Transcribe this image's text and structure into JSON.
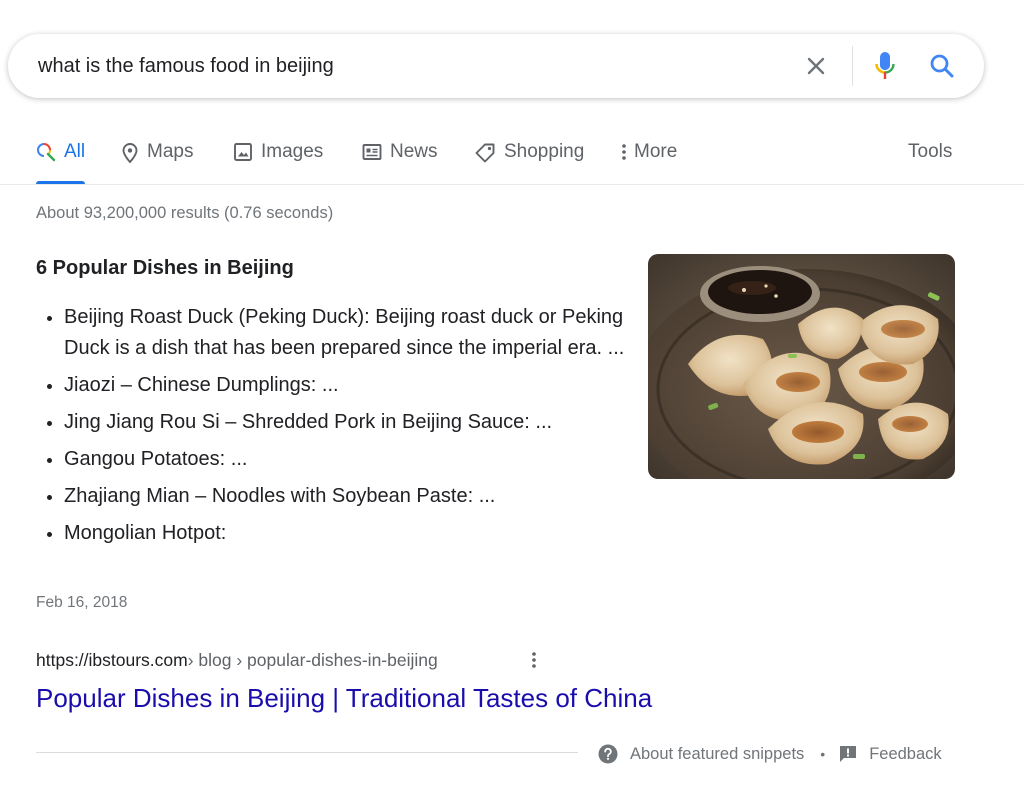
{
  "search": {
    "query": "what is the famous food in beijing"
  },
  "tabs": [
    {
      "label": "All",
      "icon": "search-icon",
      "active": true
    },
    {
      "label": "Maps",
      "icon": "map-pin-icon"
    },
    {
      "label": "Images",
      "icon": "image-icon"
    },
    {
      "label": "News",
      "icon": "newspaper-icon"
    },
    {
      "label": "Shopping",
      "icon": "tag-icon"
    },
    {
      "label": "More",
      "icon": "kebab-icon"
    }
  ],
  "tools_label": "Tools",
  "result_stats": "About 93,200,000 results (0.76 seconds)",
  "featured_snippet": {
    "title": "6 Popular Dishes in Beijing",
    "items": [
      "Beijing Roast Duck (Peking Duck): Beijing roast duck or Peking Duck is a dish that has been prepared since the imperial era. ...",
      "Jiaozi – Chinese Dumplings: ...",
      "Jing Jiang Rou Si – Shredded Pork in Beijing Sauce: ...",
      "Gangou Potatoes: ...",
      "Zhajiang Mian – Noodles with Soybean Paste: ...",
      "Mongolian Hotpot:"
    ],
    "date": "Feb 16, 2018",
    "source_url": "https://ibstours.com",
    "breadcrumbs": " › blog › popular-dishes-in-beijing",
    "result_title": "Popular Dishes in Beijing | Traditional Tastes of China"
  },
  "footer": {
    "about_label": "About featured snippets",
    "separator": "•",
    "feedback_label": "Feedback"
  },
  "colors": {
    "link": "#1a0dab",
    "accent": "#1a73e8",
    "secondary_text": "#70757a"
  }
}
